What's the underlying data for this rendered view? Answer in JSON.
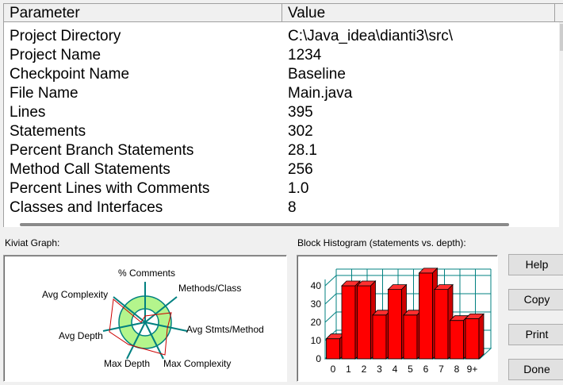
{
  "table": {
    "headers": {
      "parameter": "Parameter",
      "value": "Value"
    },
    "rows": [
      {
        "parameter": "Project Directory",
        "value": "C:\\Java_idea\\dianti3\\src\\"
      },
      {
        "parameter": "Project Name",
        "value": "1234"
      },
      {
        "parameter": "Checkpoint Name",
        "value": "Baseline"
      },
      {
        "parameter": "File Name",
        "value": "Main.java"
      },
      {
        "parameter": "Lines",
        "value": "395"
      },
      {
        "parameter": "Statements",
        "value": "302"
      },
      {
        "parameter": "Percent Branch Statements",
        "value": "28.1"
      },
      {
        "parameter": "Method Call Statements",
        "value": "256"
      },
      {
        "parameter": "Percent Lines with Comments",
        "value": "1.0"
      },
      {
        "parameter": "Classes and Interfaces",
        "value": "8"
      }
    ]
  },
  "kiviat": {
    "label": "Kiviat Graph:",
    "axes": [
      "% Comments",
      "Methods/Class",
      "Avg Stmts/Method",
      "Max Complexity",
      "Max Depth",
      "Avg Depth",
      "Avg Complexity"
    ],
    "colors": {
      "ring": "#b4f58c",
      "axis": "#008080",
      "outline": "#cc0000"
    }
  },
  "chart_data": {
    "type": "bar",
    "title": "Block Histogram (statements vs. depth):",
    "categories": [
      "0",
      "1",
      "2",
      "3",
      "4",
      "5",
      "6",
      "7",
      "8",
      "9+"
    ],
    "values": [
      11,
      40,
      40,
      24,
      38,
      24,
      47,
      38,
      21,
      22
    ],
    "yticks": [
      "0",
      "10",
      "20",
      "30",
      "40"
    ],
    "ylim": [
      0,
      40
    ],
    "grid": true,
    "bar_color": "#ff0000",
    "grid_color": "#008080"
  },
  "buttons": {
    "help": "Help",
    "copy": "Copy",
    "print": "Print",
    "done": "Done"
  }
}
